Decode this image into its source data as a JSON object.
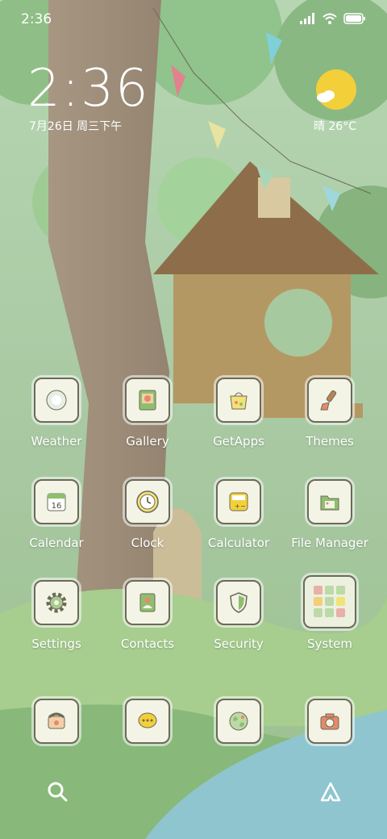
{
  "status_bar": {
    "time": "2:36"
  },
  "clock": {
    "time": "2:36",
    "date": "7月26日 周三下午"
  },
  "weather": {
    "text": "晴 26°C"
  },
  "apps": [
    {
      "label": "Weather",
      "icon": "weather-app-icon"
    },
    {
      "label": "Gallery",
      "icon": "gallery-app-icon"
    },
    {
      "label": "GetApps",
      "icon": "getapps-app-icon"
    },
    {
      "label": "Themes",
      "icon": "themes-app-icon"
    },
    {
      "label": "Calendar",
      "icon": "calendar-app-icon",
      "badge": "16"
    },
    {
      "label": "Clock",
      "icon": "clock-app-icon"
    },
    {
      "label": "Calculator",
      "icon": "calculator-app-icon"
    },
    {
      "label": "File Manager",
      "icon": "file-manager-app-icon"
    },
    {
      "label": "Settings",
      "icon": "settings-app-icon"
    },
    {
      "label": "Contacts",
      "icon": "contacts-app-icon"
    },
    {
      "label": "Security",
      "icon": "security-app-icon"
    },
    {
      "label": "System",
      "icon": "folder-icon"
    }
  ],
  "dock": [
    {
      "icon": "phone-icon"
    },
    {
      "icon": "messages-icon"
    },
    {
      "icon": "browser-icon"
    },
    {
      "icon": "camera-icon"
    }
  ],
  "colors": {
    "accent_yellow": "#f3cf3a",
    "tile_border": "#6b6a58",
    "tile_bg": "#f4f4e6"
  }
}
